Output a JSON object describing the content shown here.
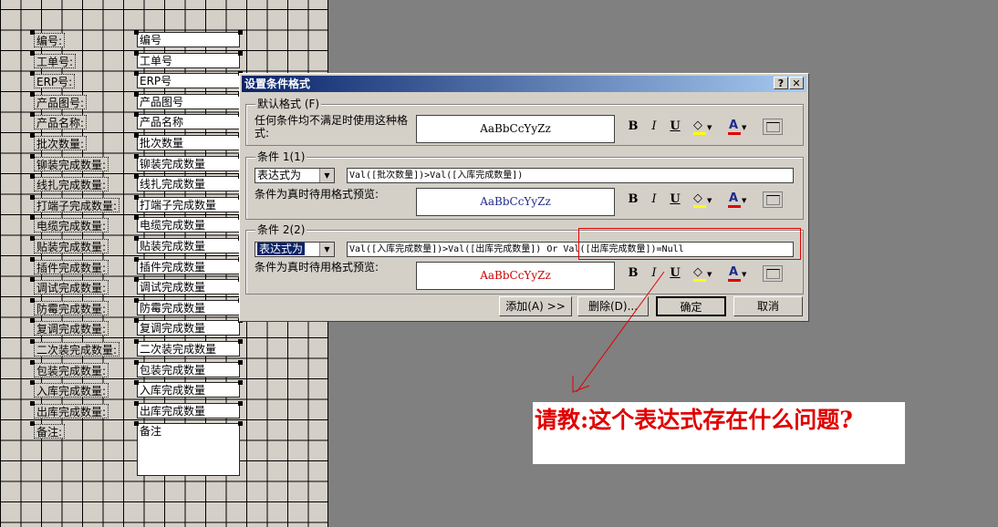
{
  "form_fields": [
    {
      "label": "编号:",
      "box": "编号"
    },
    {
      "label": "工单号:",
      "box": "工单号"
    },
    {
      "label": "ERP号:",
      "box": "ERP号"
    },
    {
      "label": "产品图号:",
      "box": "产品图号"
    },
    {
      "label": "产品名称:",
      "box": "产品名称"
    },
    {
      "label": "批次数量:",
      "box": "批次数量"
    },
    {
      "label": "铆装完成数量:",
      "box": "铆装完成数量"
    },
    {
      "label": "线扎完成数量:",
      "box": "线扎完成数量"
    },
    {
      "label": "打端子完成数量:",
      "box": "打端子完成数量"
    },
    {
      "label": "电缆完成数量:",
      "box": "电缆完成数量"
    },
    {
      "label": "贴装完成数量:",
      "box": "贴装完成数量"
    },
    {
      "label": "插件完成数量:",
      "box": "插件完成数量"
    },
    {
      "label": "调试完成数量:",
      "box": "调试完成数量"
    },
    {
      "label": "防霉完成数量:",
      "box": "防霉完成数量"
    },
    {
      "label": "复调完成数量:",
      "box": "复调完成数量"
    },
    {
      "label": "二次装完成数量:",
      "box": "二次装完成数量"
    },
    {
      "label": "包装完成数量:",
      "box": "包装完成数量"
    },
    {
      "label": "入库完成数量:",
      "box": "入库完成数量"
    },
    {
      "label": "出库完成数量:",
      "box": "出库完成数量"
    },
    {
      "label": "备注:",
      "box": "备注"
    }
  ],
  "dialog": {
    "title": "设置条件格式",
    "help_label": "?",
    "close_label": "✕",
    "default": {
      "title": "默认格式 (F)",
      "desc": "任何条件均不满足时使用这种格式:",
      "preview": "AaBbCcYyZz",
      "preview_color": "#000000"
    },
    "conditions": [
      {
        "title": "条件 1(1)",
        "type": "表达式为",
        "expression": "Val([批次数量])>Val([入库完成数量])",
        "preview_label": "条件为真时待用格式预览:",
        "preview": "AaBbCcYyZz",
        "preview_color": "#1f2a8a"
      },
      {
        "title": "条件 2(2)",
        "type": "表达式为",
        "expression": "Val([入库完成数量])>Val([出库完成数量]) Or Val([出库完成数量])=Null",
        "preview_label": "条件为真时待用格式预览:",
        "preview": "AaBbCcYyZz",
        "preview_color": "#cc0000"
      }
    ],
    "format_buttons": {
      "bold": "B",
      "italic": "I",
      "underline": "U"
    },
    "icons": {
      "fill": "paint-bucket-icon",
      "font_color": "font-color-icon",
      "border": "border-icon"
    },
    "colors": {
      "fill_bar": "#ffff00",
      "font_bar": "#e00000",
      "title_start": "#0a246a",
      "title_end": "#a6caf0"
    },
    "buttons": {
      "add": "添加(A) >>",
      "delete": "删除(D)...",
      "ok": "确定",
      "cancel": "取消"
    }
  },
  "annotation": {
    "question": "请教:这个表达式存在什么问题?",
    "color": "#e00000"
  }
}
